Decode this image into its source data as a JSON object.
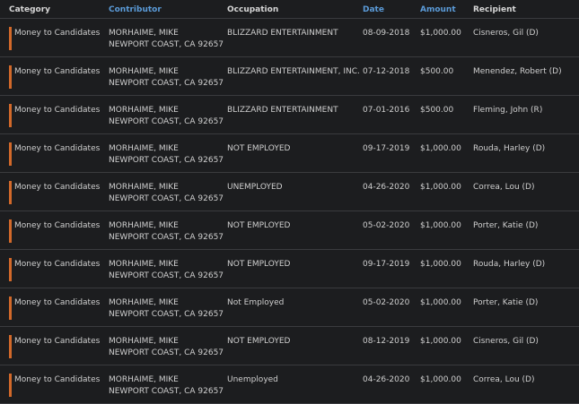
{
  "colors": {
    "background": "#1c1d1f",
    "header_text": "#d6d6d6",
    "sortable_header_text": "#5b9bd8",
    "category_bar": "#d2692a",
    "row_divider": "#3a3b3e",
    "cell_text": "#cfcfcf"
  },
  "headers": {
    "category": "Category",
    "contributor": "Contributor",
    "occupation": "Occupation",
    "date": "Date",
    "amount": "Amount",
    "recipient": "Recipient"
  },
  "rows": [
    {
      "category": "Money to Candidates",
      "contributor_name": "MORHAIME, MIKE",
      "contributor_location": "NEWPORT COAST, CA 92657",
      "occupation": "BLIZZARD ENTERTAINMENT",
      "date": "08-09-2018",
      "amount": "$1,000.00",
      "recipient": "Cisneros, Gil (D)"
    },
    {
      "category": "Money to Candidates",
      "contributor_name": "MORHAIME, MIKE",
      "contributor_location": "NEWPORT COAST, CA 92657",
      "occupation": "BLIZZARD ENTERTAINMENT, INC.",
      "date": "07-12-2018",
      "amount": "$500.00",
      "recipient": "Menendez, Robert (D)"
    },
    {
      "category": "Money to Candidates",
      "contributor_name": "MORHAIME, MIKE",
      "contributor_location": "NEWPORT COAST, CA 92657",
      "occupation": "BLIZZARD ENTERTAINMENT",
      "date": "07-01-2016",
      "amount": "$500.00",
      "recipient": "Fleming, John (R)"
    },
    {
      "category": "Money to Candidates",
      "contributor_name": "MORHAIME, MIKE",
      "contributor_location": "NEWPORT COAST, CA 92657",
      "occupation": "NOT EMPLOYED",
      "date": "09-17-2019",
      "amount": "$1,000.00",
      "recipient": "Rouda, Harley (D)"
    },
    {
      "category": "Money to Candidates",
      "contributor_name": "MORHAIME, MIKE",
      "contributor_location": "NEWPORT COAST, CA 92657",
      "occupation": "UNEMPLOYED",
      "date": "04-26-2020",
      "amount": "$1,000.00",
      "recipient": "Correa, Lou (D)"
    },
    {
      "category": "Money to Candidates",
      "contributor_name": "MORHAIME, MIKE",
      "contributor_location": "NEWPORT COAST, CA 92657",
      "occupation": "NOT EMPLOYED",
      "date": "05-02-2020",
      "amount": "$1,000.00",
      "recipient": "Porter, Katie (D)"
    },
    {
      "category": "Money to Candidates",
      "contributor_name": "MORHAIME, MIKE",
      "contributor_location": "NEWPORT COAST, CA 92657",
      "occupation": "NOT EMPLOYED",
      "date": "09-17-2019",
      "amount": "$1,000.00",
      "recipient": "Rouda, Harley (D)"
    },
    {
      "category": "Money to Candidates",
      "contributor_name": "MORHAIME, MIKE",
      "contributor_location": "NEWPORT COAST, CA 92657",
      "occupation": "Not Employed",
      "date": "05-02-2020",
      "amount": "$1,000.00",
      "recipient": "Porter, Katie (D)"
    },
    {
      "category": "Money to Candidates",
      "contributor_name": "MORHAIME, MIKE",
      "contributor_location": "NEWPORT COAST, CA 92657",
      "occupation": "NOT EMPLOYED",
      "date": "08-12-2019",
      "amount": "$1,000.00",
      "recipient": "Cisneros, Gil (D)"
    },
    {
      "category": "Money to Candidates",
      "contributor_name": "MORHAIME, MIKE",
      "contributor_location": "NEWPORT COAST, CA 92657",
      "occupation": "Unemployed",
      "date": "04-26-2020",
      "amount": "$1,000.00",
      "recipient": "Correa, Lou (D)"
    }
  ]
}
